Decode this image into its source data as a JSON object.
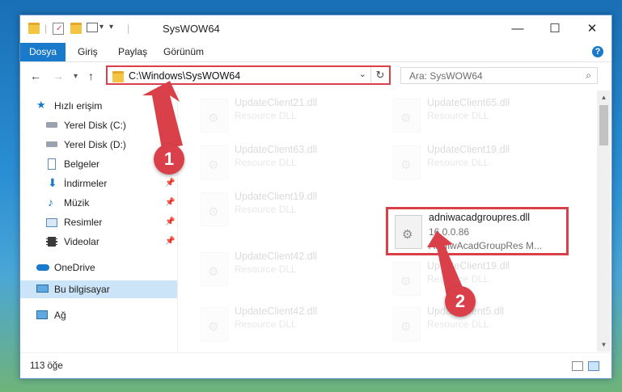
{
  "title_bar": {
    "title": "SysWOW64",
    "qa_separator": "|",
    "qa_dropdown": "▾",
    "minimize": "—",
    "maximize": "☐",
    "close": "✕"
  },
  "ribbon": {
    "tabs": [
      "Dosya",
      "Giriş",
      "Paylaş",
      "Görünüm"
    ],
    "help": "?"
  },
  "nav": {
    "back": "←",
    "forward": "→",
    "recent": "▾",
    "up": "↑",
    "address": "C:\\Windows\\SysWOW64",
    "address_dropdown": "⌄",
    "refresh": "↻",
    "search_placeholder": "Ara: SysWOW64"
  },
  "sidebar": {
    "items": [
      {
        "label": "Hızlı erişim",
        "icon": "star-icon",
        "pinned": false
      },
      {
        "label": "Yerel Disk (C:)",
        "icon": "drive-icon",
        "pinned": true
      },
      {
        "label": "Yerel Disk (D:)",
        "icon": "drive-icon",
        "pinned": false
      },
      {
        "label": "Belgeler",
        "icon": "documents-icon",
        "pinned": true
      },
      {
        "label": "İndirmeler",
        "icon": "downloads-icon",
        "pinned": true
      },
      {
        "label": "Müzik",
        "icon": "music-icon",
        "pinned": true
      },
      {
        "label": "Resimler",
        "icon": "pictures-icon",
        "pinned": true
      },
      {
        "label": "Videolar",
        "icon": "videos-icon",
        "pinned": true
      },
      {
        "label": "OneDrive",
        "icon": "onedrive-icon",
        "pinned": false
      },
      {
        "label": "Bu bilgisayar",
        "icon": "this-pc-icon",
        "pinned": false
      },
      {
        "label": "Ağ",
        "icon": "network-icon",
        "pinned": false
      }
    ],
    "pin_glyph": "📌"
  },
  "files": {
    "tiles": [
      {
        "name": "UpdateClient21.dll",
        "sub": "Resource DLL"
      },
      {
        "name": "UpdateClient65.dll",
        "sub": "Resource DLL"
      },
      {
        "name": "UpdateClient63.dll",
        "sub": "Resource DLL"
      },
      {
        "name": "UpdateClient19.dll",
        "sub": "Resource DLL"
      },
      {
        "name": "UpdateClient19.dll",
        "sub": "Resource DLL"
      },
      {
        "name": "adniwacadgroupres.dll",
        "sub": "16.0.0.86",
        "sub2": "AdNiwAcadGroupRes M..."
      },
      {
        "name": "UpdateClient42.dll",
        "sub": "Resource DLL"
      },
      {
        "name": "UpdateClient19.dll",
        "sub": "Resource DLL"
      },
      {
        "name": "UpdateClient42.dll",
        "sub": "Resource DLL"
      },
      {
        "name": "UpdateClient5.dll",
        "sub": "Resource DLL"
      }
    ]
  },
  "status": {
    "count": "113 öğe"
  },
  "callouts": {
    "one": "1",
    "two": "2"
  },
  "colors": {
    "accent": "#1979ca",
    "highlight": "#d9404a",
    "selected_row": "#cce4f7"
  }
}
